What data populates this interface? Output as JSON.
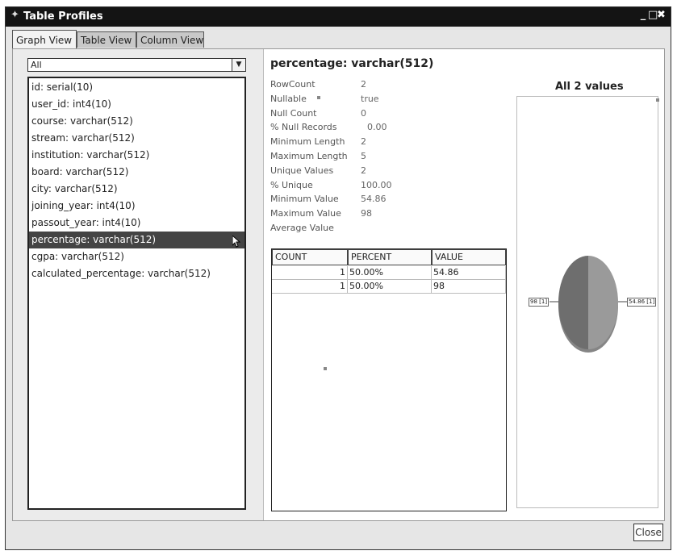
{
  "window": {
    "title": "Table Profiles",
    "controls": [
      "minimize-icon",
      "maximize-icon",
      "close-icon"
    ]
  },
  "tabs": [
    {
      "label": "Graph View",
      "active": true
    },
    {
      "label": "Table View",
      "active": false
    },
    {
      "label": "Column View",
      "active": false
    }
  ],
  "filter": {
    "selected": "All"
  },
  "columns": [
    "id: serial(10)",
    "user_id: int4(10)",
    "course: varchar(512)",
    "stream: varchar(512)",
    "institution: varchar(512)",
    "board: varchar(512)",
    "city: varchar(512)",
    "joining_year: int4(10)",
    "passout_year: int4(10)",
    "percentage: varchar(512)",
    "cgpa: varchar(512)",
    "calculated_percentage: varchar(512)"
  ],
  "selected_column_index": 9,
  "details": {
    "title": "percentage: varchar(512)",
    "stats": [
      {
        "label": "RowCount",
        "value": "2"
      },
      {
        "label": "Nullable",
        "value": "true"
      },
      {
        "label": "Null Count",
        "value": "0"
      },
      {
        "label": "% Null Records",
        "value": "0.00"
      },
      {
        "label": "Minimum Length",
        "value": "2"
      },
      {
        "label": "Maximum Length",
        "value": "5"
      },
      {
        "label": "Unique Values",
        "value": "2"
      },
      {
        "label": "% Unique",
        "value": "100.00"
      },
      {
        "label": "Minimum Value",
        "value": "54.86"
      },
      {
        "label": "Maximum Value",
        "value": "98"
      },
      {
        "label": "Average Value",
        "value": ""
      }
    ]
  },
  "value_table": {
    "headers": [
      "COUNT",
      "PERCENT",
      "VALUE"
    ],
    "rows": [
      [
        "1",
        "50.00%",
        "54.86"
      ],
      [
        "1",
        "50.00%",
        "98"
      ]
    ]
  },
  "chart_data": {
    "type": "pie",
    "title": "All 2 values",
    "slices": [
      {
        "label": "54.86 [1]",
        "value": 1,
        "color": "#9a9a9a"
      },
      {
        "label": "98 [1]",
        "value": 1,
        "color": "#6e6e6e"
      }
    ]
  },
  "buttons": {
    "close_label": "Close"
  }
}
